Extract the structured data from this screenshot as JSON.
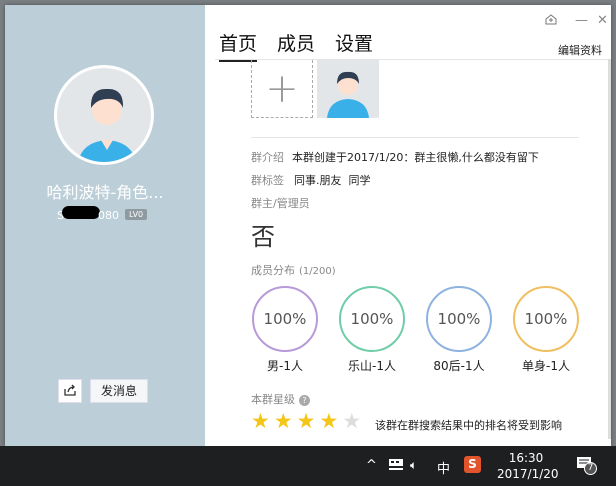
{
  "profile": {
    "name": "哈利波特-角色...",
    "id_prefix": "S",
    "id_suffix": "080",
    "level": "LV0",
    "message_button": "发消息"
  },
  "tabs": [
    {
      "label": "首页",
      "active": true
    },
    {
      "label": "成员"
    },
    {
      "label": "设置"
    }
  ],
  "window": {
    "edit_profile": "编辑资料",
    "minimize": "—",
    "close": "✕"
  },
  "info": {
    "intro_label": "群介绍",
    "intro": "本群创建于2017/1/20：群主很懒,什么都没有留下",
    "tags_label": "群标签",
    "tags": "同事.朋友  同学",
    "admins_label": "群主/管理员",
    "admin_avatar_glyph": "否",
    "distribution_label": "成员分布",
    "distribution_count": "(1/200)"
  },
  "distribution": [
    {
      "value": "100%",
      "label": "男-1人",
      "color": "#b79ad8"
    },
    {
      "value": "100%",
      "label": "乐山-1人",
      "color": "#6fcda8"
    },
    {
      "value": "100%",
      "label": "80后-1人",
      "color": "#8fb3e0"
    },
    {
      "value": "100%",
      "label": "单身-1人",
      "color": "#f0c060"
    }
  ],
  "rating": {
    "label": "本群星级",
    "help": "?",
    "stars": 4,
    "max": 5,
    "note": "该群在群搜索结果中的排名将受到影响"
  },
  "taskbar": {
    "chevron": "^",
    "ime": "中",
    "sogou": "S",
    "time": "16:30",
    "date": "2017/1/20",
    "notifications": "7"
  }
}
